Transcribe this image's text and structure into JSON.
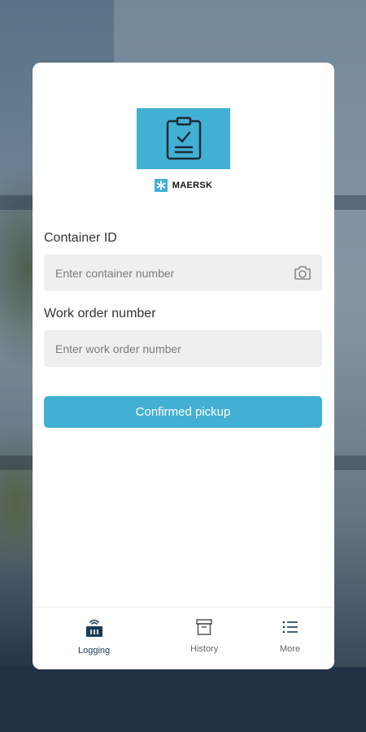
{
  "brand": {
    "name": "MAERSK",
    "accent": "#42b0d5"
  },
  "form": {
    "container_label": "Container ID",
    "container_placeholder": "Enter container number",
    "work_order_label": "Work order number",
    "work_order_placeholder": "Enter work order number",
    "submit_label": "Confirmed pickup"
  },
  "nav": {
    "items": [
      {
        "label": "Logging",
        "icon": "logging-icon",
        "active": true
      },
      {
        "label": "History",
        "icon": "history-icon",
        "active": false
      },
      {
        "label": "More",
        "icon": "menu-list-icon",
        "active": false
      }
    ]
  }
}
